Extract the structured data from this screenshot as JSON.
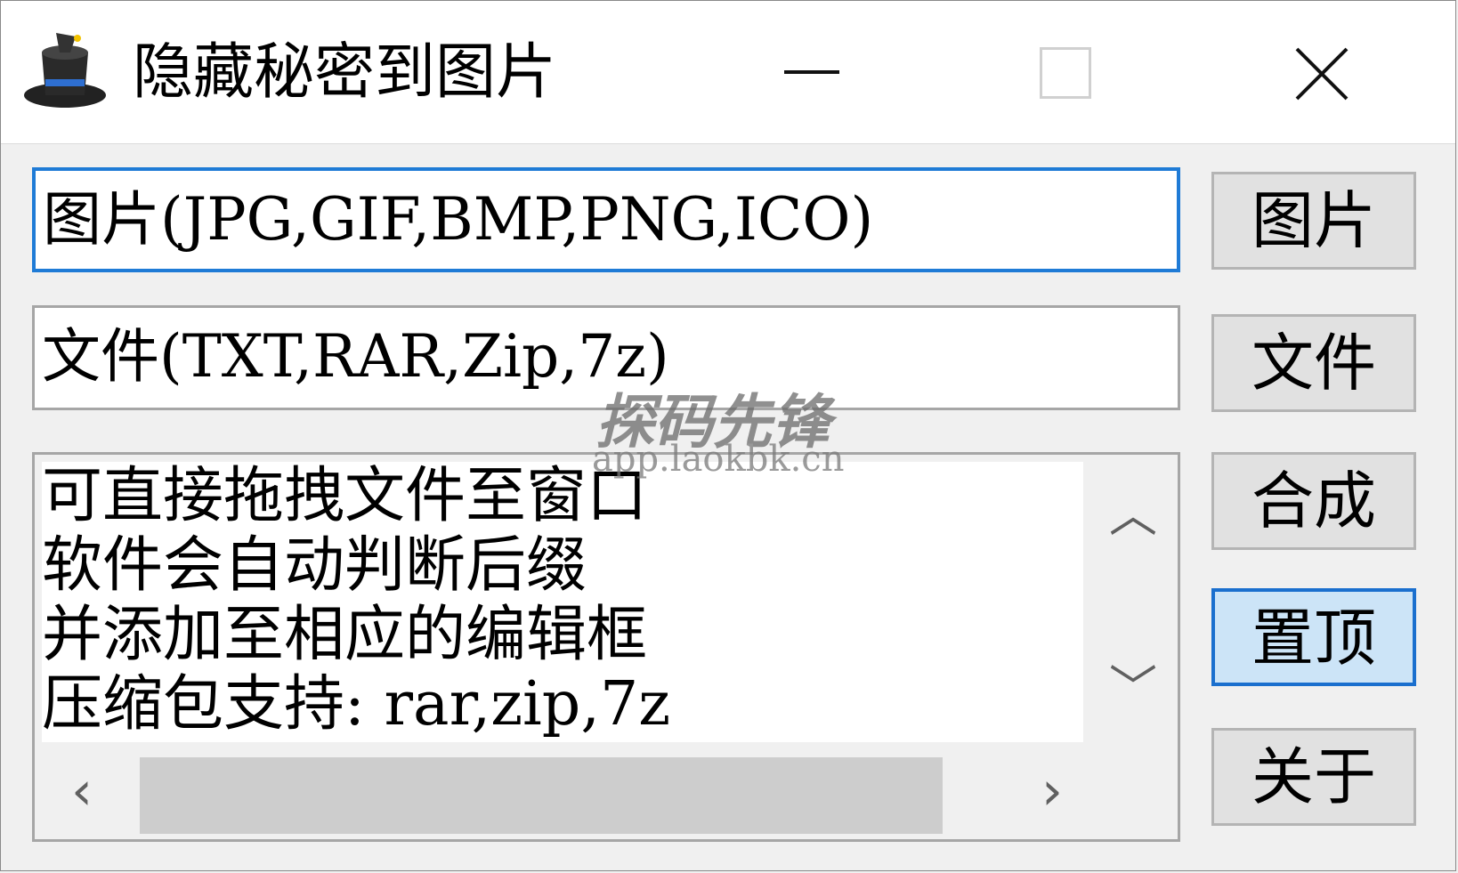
{
  "window": {
    "title": "隐藏秘密到图片",
    "icon": "magic-hat-icon",
    "controls": {
      "minimize": "minimize-icon",
      "maximize": "maximize-icon",
      "close": "close-icon"
    }
  },
  "fields": {
    "image_placeholder": "图片(JPG,GIF,BMP,PNG,ICO)",
    "file_placeholder": "文件(TXT,RAR,Zip,7z)"
  },
  "buttons": {
    "image": "图片",
    "file": "文件",
    "merge": "合成",
    "pin_top": "置顶",
    "about": "关于"
  },
  "memo": {
    "lines": [
      "可直接拖拽文件至窗口",
      "软件会自动判断后缀",
      "并添加至相应的编辑框",
      "压缩包支持: rar,zip,7z"
    ]
  },
  "watermark": {
    "text": "探码先锋",
    "url": "app.laokbk.cn"
  },
  "colors": {
    "focus_border": "#1f7bd6",
    "active_button_bg": "#cce4f7",
    "window_bg": "#f0f0f0"
  }
}
